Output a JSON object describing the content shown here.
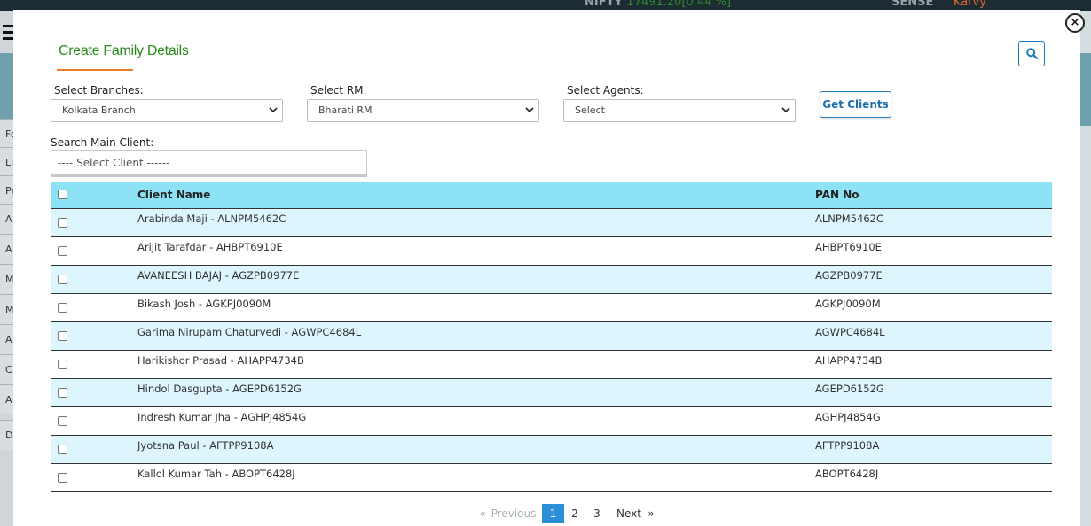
{
  "background": {
    "ticker_nifty_label": "NIFTY",
    "ticker_nifty_value": "17491.20[0.44 %]",
    "ticker_sensex_label": "SENSE",
    "ticker_brand": "Karvy",
    "side_rows": [
      "Fo",
      "Li",
      "Pr",
      "A",
      "A",
      "M",
      "M",
      "A",
      "C",
      "A",
      "D"
    ]
  },
  "modal": {
    "close_label": "×",
    "title": "Create Family Details",
    "filters": {
      "branches_label": "Select Branches:",
      "branches_value": "Kolkata Branch",
      "rm_label": "Select RM:",
      "rm_value": "Bharati RM",
      "agents_label": "Select Agents:",
      "agents_value": "Select",
      "get_clients_label": "Get Clients"
    },
    "search": {
      "label": "Search Main Client:",
      "value": "---- Select Client ------"
    },
    "table": {
      "headers": {
        "name": "Client Name",
        "pan": "PAN No"
      },
      "rows": [
        {
          "name": "Arabinda Maji - ALNPM5462C",
          "pan": "ALNPM5462C"
        },
        {
          "name": "Arijit Tarafdar - AHBPT6910E",
          "pan": "AHBPT6910E"
        },
        {
          "name": "AVANEESH BAJAJ - AGZPB0977E",
          "pan": "AGZPB0977E"
        },
        {
          "name": "Bikash Josh - AGKPJ0090M",
          "pan": "AGKPJ0090M"
        },
        {
          "name": "Garima Nirupam Chaturvedi - AGWPC4684L",
          "pan": "AGWPC4684L"
        },
        {
          "name": "Harikishor Prasad - AHAPP4734B",
          "pan": "AHAPP4734B"
        },
        {
          "name": "Hindol Dasgupta - AGEPD6152G",
          "pan": "AGEPD6152G"
        },
        {
          "name": "Indresh Kumar Jha - AGHPJ4854G",
          "pan": "AGHPJ4854G"
        },
        {
          "name": "Jyotsna Paul - AFTPP9108A",
          "pan": "AFTPP9108A"
        },
        {
          "name": "Kallol Kumar Tah - ABOPT6428J",
          "pan": "ABOPT6428J"
        }
      ]
    },
    "pagination": {
      "prev_arrow": "«",
      "previous": "Previous",
      "pages": [
        "1",
        "2",
        "3"
      ],
      "active_page": "1",
      "next": "Next",
      "next_arrow": "»"
    }
  }
}
